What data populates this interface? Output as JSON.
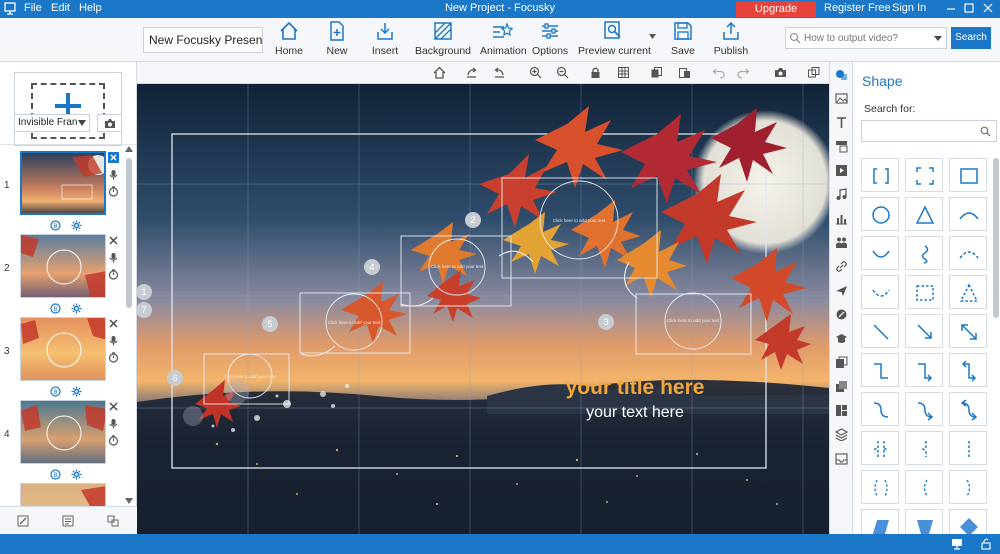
{
  "app": {
    "title": "New Project - Focusky",
    "menu": [
      "File",
      "Edit",
      "Help"
    ],
    "upgrade_label": "Upgrade account",
    "register_label": "Register Free",
    "signin_label": "Sign In"
  },
  "toolbar": {
    "project_name": "New Focusky Presenta",
    "buttons": [
      {
        "label": "Home",
        "icon": "home-icon"
      },
      {
        "label": "New",
        "icon": "new-icon"
      },
      {
        "label": "Insert",
        "icon": "insert-icon"
      },
      {
        "label": "Background",
        "icon": "background-icon"
      },
      {
        "label": "Animation",
        "icon": "animation-icon"
      },
      {
        "label": "Options",
        "icon": "options-icon"
      },
      {
        "label": "Preview current",
        "icon": "preview-icon"
      },
      {
        "label": "Save",
        "icon": "save-icon"
      },
      {
        "label": "Publish",
        "icon": "publish-icon"
      }
    ],
    "search_placeholder": "How to output video?",
    "search_button": "Search"
  },
  "left_panel": {
    "frame_type": "Invisible Fran",
    "frames": [
      {
        "number": "1",
        "selected": true
      },
      {
        "number": "2",
        "selected": false
      },
      {
        "number": "3",
        "selected": false
      },
      {
        "number": "4",
        "selected": false
      },
      {
        "number": "",
        "selected": false
      }
    ]
  },
  "canvas": {
    "title": "your title here",
    "subtitle": "your text here",
    "path_numbers": [
      "1",
      "2",
      "3",
      "4",
      "5",
      "6",
      "7"
    ],
    "placeholder_text": "Click here to add your text"
  },
  "right_panel": {
    "title": "Shape",
    "search_label": "Search for:"
  },
  "colors": {
    "accent": "#1b78c8",
    "upgrade": "#e7433b",
    "title_text": "#f1a73a"
  }
}
